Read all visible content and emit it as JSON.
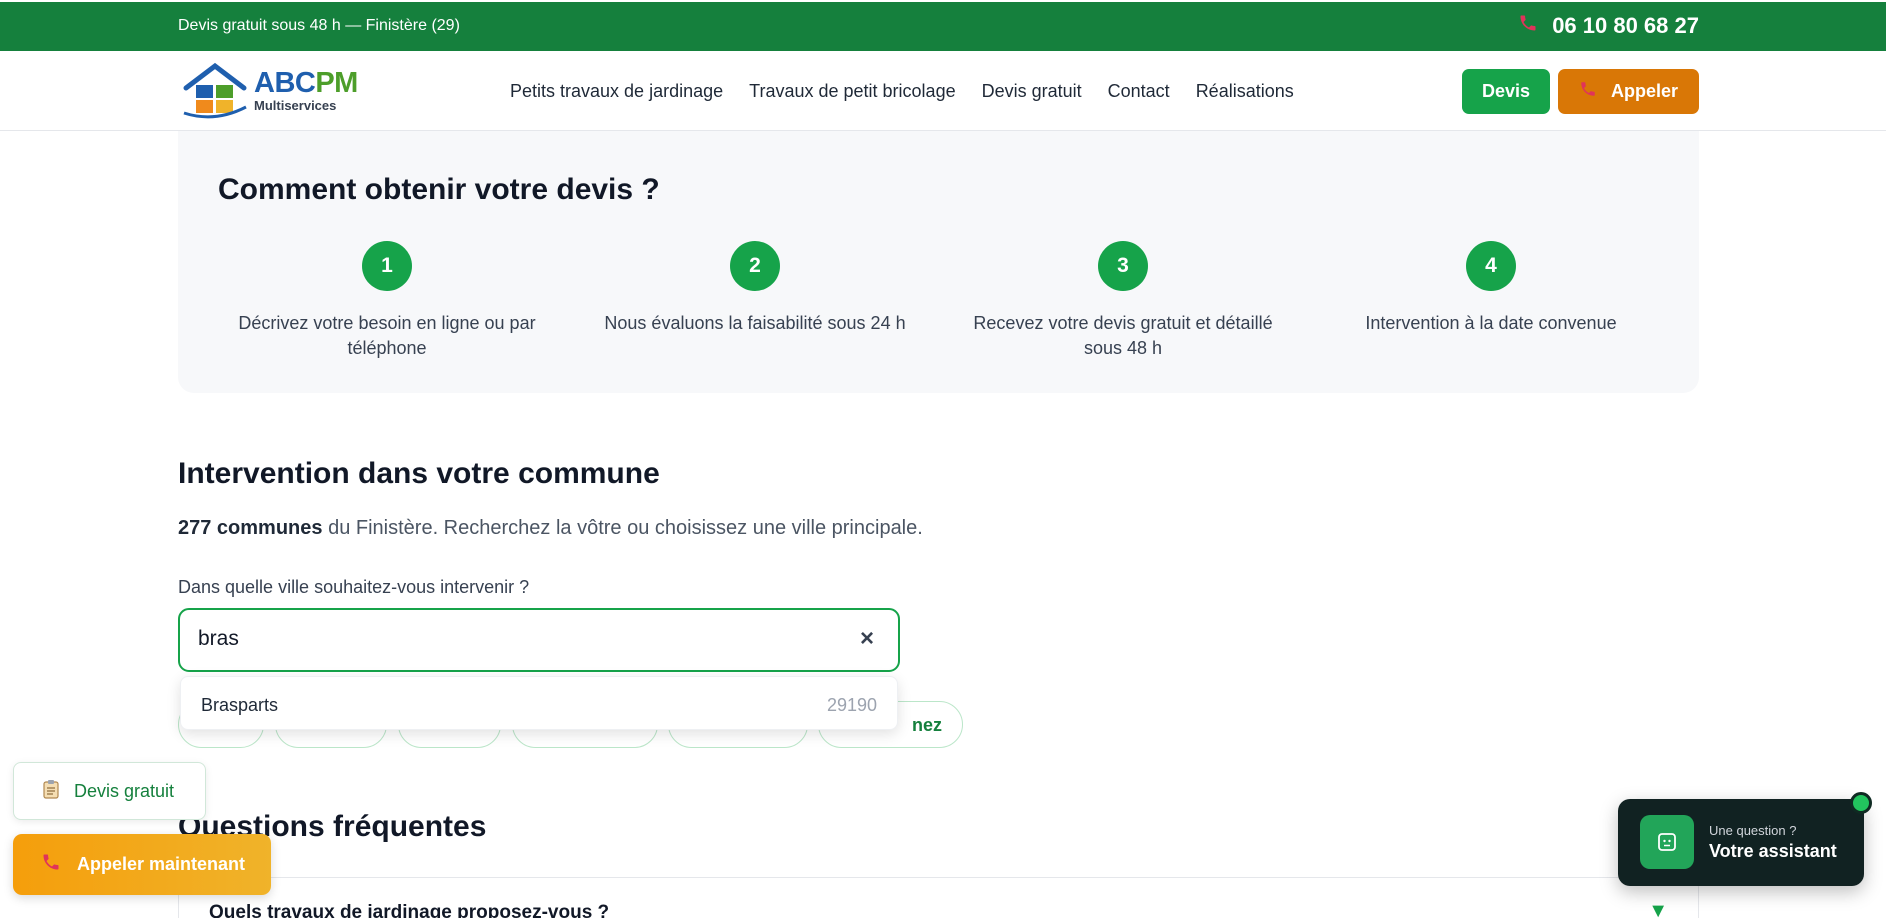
{
  "topbar": {
    "tagline": "Devis gratuit sous 48 h — Finistère (29)",
    "phone": "06 10 80 68 27"
  },
  "brand": {
    "name_part1": "ABC",
    "name_part2": "PM",
    "subtitle": "Multiservices"
  },
  "nav": {
    "items": [
      {
        "label": "Petits travaux de jardinage"
      },
      {
        "label": "Travaux de petit bricolage"
      },
      {
        "label": "Devis gratuit"
      },
      {
        "label": "Contact"
      },
      {
        "label": "Réalisations"
      }
    ],
    "devis_label": "Devis",
    "appeler_label": "Appeler"
  },
  "steps": {
    "title": "Comment obtenir votre devis ?",
    "items": [
      {
        "num": "1",
        "text": "Décrivez votre besoin en ligne ou par téléphone"
      },
      {
        "num": "2",
        "text": "Nous évaluons la faisabilité sous 24 h"
      },
      {
        "num": "3",
        "text": "Recevez votre devis gratuit et détaillé sous 48 h"
      },
      {
        "num": "4",
        "text": "Intervention à la date convenue"
      }
    ]
  },
  "communes": {
    "title": "Intervention dans votre commune",
    "count_bold": "277 communes",
    "subtitle_rest": " du Finistère. Recherchez la vôtre ou choisissez une ville principale.",
    "field_label": "Dans quelle ville souhaitez-vous intervenir ?",
    "search_value": "bras",
    "chip_visible_text": "nez",
    "suggestion": {
      "city": "Brasparts",
      "zip": "29190"
    }
  },
  "faq": {
    "title": "Questions fréquentes",
    "first_question": "Quels travaux de jardinage proposez-vous ?"
  },
  "floating": {
    "devis_label": "Devis gratuit",
    "appeler_label": "Appeler maintenant"
  },
  "assistant": {
    "line1": "Une question ?",
    "line2": "Votre assistant"
  },
  "colors": {
    "primary_green": "#15803d",
    "button_green": "#16a34a",
    "orange": "#d97706",
    "phone_icon_red": "#e0335a"
  }
}
